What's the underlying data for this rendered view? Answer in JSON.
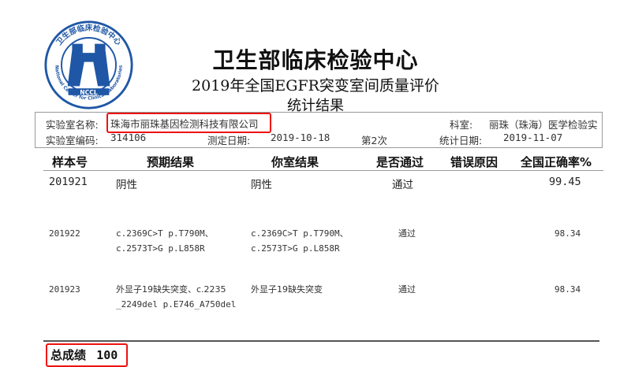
{
  "header": {
    "logo": {
      "ring_text": "卫生部临床检验中心",
      "english_text": "National Center for Clinical Laboratories",
      "abbr": "NCCL"
    },
    "title": "卫生部临床检验中心",
    "subtitle": "2019年全国EGFR突变室间质量评价",
    "subtitle2": "统计结果"
  },
  "info": {
    "lab_name_label": "实验室名称:",
    "lab_name": "珠海市丽珠基因检测科技有限公司",
    "dept_label": "科室:",
    "dept": "丽珠（珠海）医学检验实",
    "lab_code_label": "实验室编码:",
    "lab_code": "314106",
    "test_date_label": "测定日期:",
    "test_date": "2019-10-18",
    "round": "第2次",
    "stat_date_label": "统计日期:",
    "stat_date": "2019-11-07"
  },
  "table": {
    "headers": [
      "样本号",
      "预期结果",
      "你室结果",
      "是否通过",
      "错误原因",
      "全国正确率%"
    ],
    "rows": [
      {
        "sample": "201921",
        "expected": [
          "阴性"
        ],
        "yours": [
          "阴性"
        ],
        "pass": "通过",
        "reason": "",
        "rate": "99.45"
      },
      {
        "sample": "201922",
        "expected": [
          "c.2369C>T p.T790M、",
          "c.2573T>G p.L858R"
        ],
        "yours": [
          "c.2369C>T p.T790M、",
          "c.2573T>G p.L858R"
        ],
        "pass": "通过",
        "reason": "",
        "rate": "98.34"
      },
      {
        "sample": "201923",
        "expected": [
          "外显子19缺失突变、c.2235",
          "_2249del p.E746_A750del"
        ],
        "yours": [
          "外显子19缺失突变"
        ],
        "pass": "通过",
        "reason": "",
        "rate": "98.34"
      }
    ]
  },
  "footer": {
    "total_label": "总成绩",
    "total_score": "100"
  },
  "colors": {
    "logo_blue": "#1f57a6",
    "highlight_red": "#e11111"
  }
}
